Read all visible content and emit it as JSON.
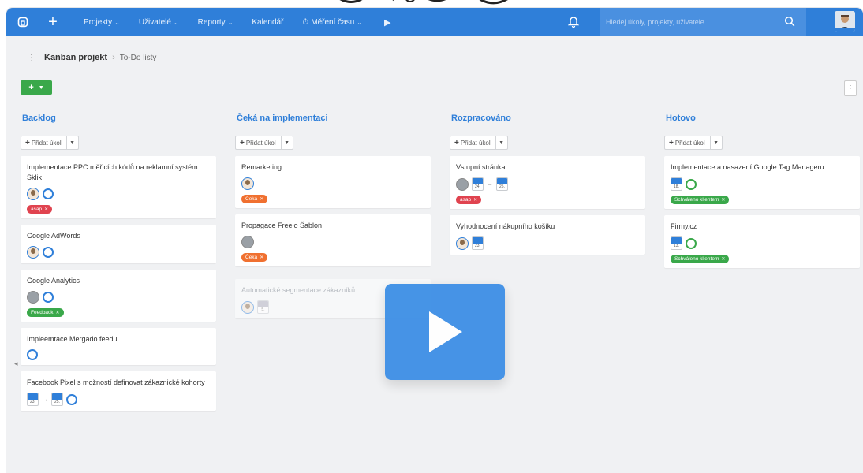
{
  "nav": {
    "items": [
      {
        "label": "Projekty",
        "chevron": true
      },
      {
        "label": "Uživatelé",
        "chevron": true
      },
      {
        "label": "Reporty",
        "chevron": true
      },
      {
        "label": "Kalendář",
        "chevron": false
      },
      {
        "label": "Měření času",
        "chevron": true
      }
    ],
    "search_placeholder": "Hledej úkoly, projekty, uživatele..."
  },
  "breadcrumb": {
    "project": "Kanban projekt",
    "current": "To-Do listy"
  },
  "add_task_label": "Přidat úkol",
  "colors": {
    "accent": "#2f7fd9",
    "tag_red": "#e0434f",
    "tag_orange": "#f07030",
    "tag_green": "#3aa84a"
  },
  "columns": [
    {
      "title": "Backlog",
      "cards": [
        {
          "title": "Implementace PPC měřicích kódů na reklamní systém Sklik",
          "tags": [
            "asap"
          ]
        },
        {
          "title": "Google AdWords",
          "tags": []
        },
        {
          "title": "Google Analytics",
          "tags": [
            "Feedback"
          ]
        },
        {
          "title": "Impleemtace Mergado feedu",
          "tags": []
        },
        {
          "title": "Facebook Pixel s možností definovat zákaznické kohorty",
          "dates": [
            "23.",
            "25."
          ]
        }
      ]
    },
    {
      "title": "Čeká na implementaci",
      "cards": [
        {
          "title": "Remarketing",
          "tags": [
            "Čeká"
          ]
        },
        {
          "title": "Propagace Freelo Šablon",
          "tags": [
            "Čeká"
          ]
        },
        {
          "title": "Automatické segmentace zákazníků",
          "dates": [
            "5."
          ]
        }
      ]
    },
    {
      "title": "Rozpracováno",
      "cards": [
        {
          "title": "Vstupní stránka",
          "dates": [
            "24.",
            "25."
          ],
          "tags": [
            "asap"
          ]
        },
        {
          "title": "Vyhodnocení nákupního košíku",
          "dates": [
            "23."
          ]
        }
      ]
    },
    {
      "title": "Hotovo",
      "cards": [
        {
          "title": "Implementace a nasazení Google Tag Manageru",
          "dates": [
            "18."
          ],
          "tags": [
            "Schváleno klientem"
          ]
        },
        {
          "title": "Firmy.cz",
          "dates": [
            "13."
          ],
          "tags": [
            "Schváleno klientem"
          ]
        }
      ]
    }
  ]
}
